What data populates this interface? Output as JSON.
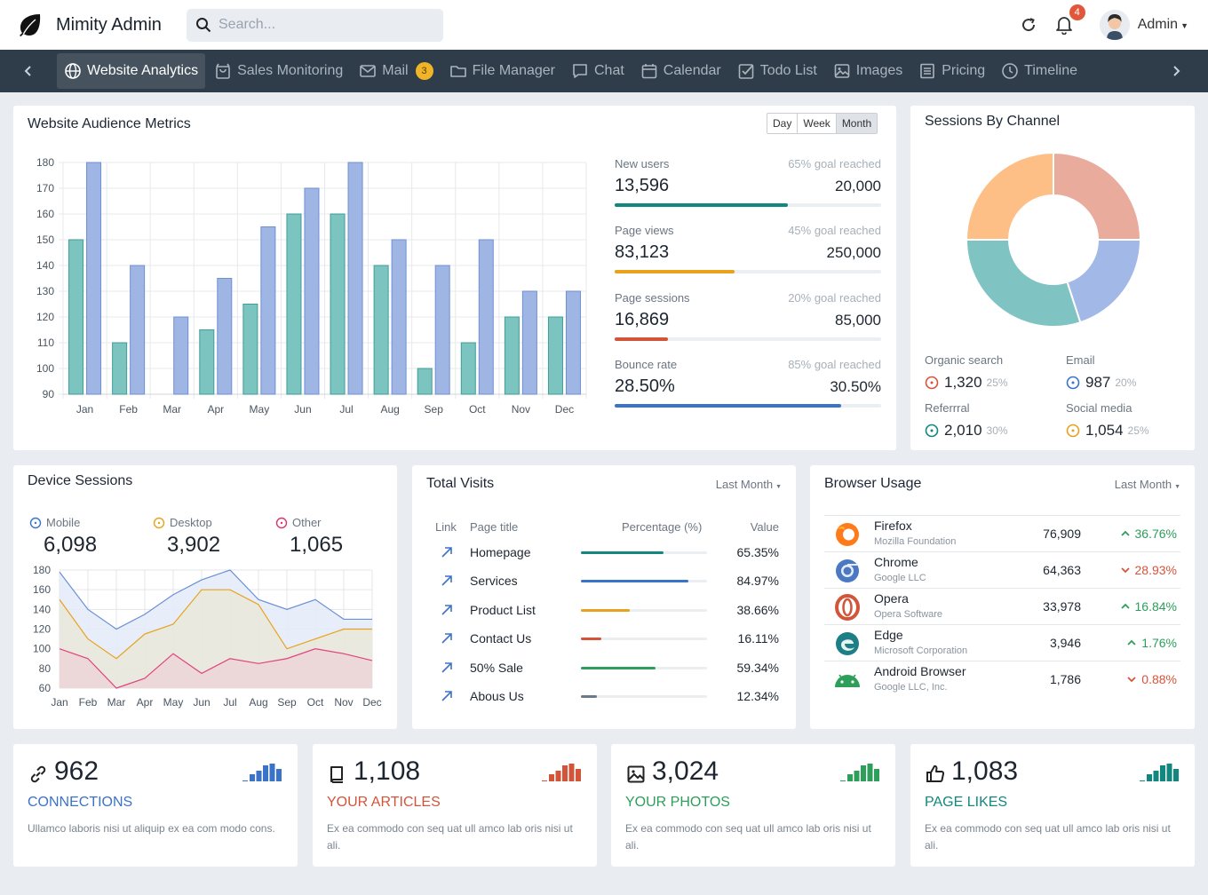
{
  "app": {
    "title": "Mimity Admin",
    "search_placeholder": "Search...",
    "notifications": "4",
    "user": "Admin"
  },
  "nav": {
    "items": [
      {
        "label": "Website Analytics",
        "icon": "globe-icon"
      },
      {
        "label": "Sales Monitoring",
        "icon": "bag-icon"
      },
      {
        "label": "Mail",
        "icon": "mail-icon",
        "badge": "3"
      },
      {
        "label": "File Manager",
        "icon": "folder-icon"
      },
      {
        "label": "Chat",
        "icon": "chat-icon"
      },
      {
        "label": "Calendar",
        "icon": "calendar-icon"
      },
      {
        "label": "Todo List",
        "icon": "checkbox-icon"
      },
      {
        "label": "Images",
        "icon": "image-icon"
      },
      {
        "label": "Pricing",
        "icon": "list-icon"
      },
      {
        "label": "Timeline",
        "icon": "clock-icon"
      }
    ]
  },
  "metrics": {
    "title": "Website Audience Metrics",
    "ranges": [
      "Day",
      "Week",
      "Month"
    ],
    "stats": [
      {
        "label": "New users",
        "goal": "65% goal reached",
        "value": "13,596",
        "total": "20,000",
        "progress": 65,
        "color": "#12877f"
      },
      {
        "label": "Page views",
        "goal": "45% goal reached",
        "value": "83,123",
        "total": "250,000",
        "progress": 45,
        "color": "#e8a21b"
      },
      {
        "label": "Page sessions",
        "goal": "20% goal reached",
        "value": "16,869",
        "total": "85,000",
        "progress": 20,
        "color": "#d2553a"
      },
      {
        "label": "Bounce rate",
        "goal": "85% goal reached",
        "value": "28.50%",
        "total": "30.50%",
        "progress": 85,
        "color": "#3b73c8"
      }
    ]
  },
  "channels": {
    "title": "Sessions By Channel",
    "items": [
      {
        "label": "Organic search",
        "value": "1,320",
        "pct": "25%",
        "color": "#d9533b"
      },
      {
        "label": "Email",
        "value": "987",
        "pct": "20%",
        "color": "#3b73c8"
      },
      {
        "label": "Referrral",
        "value": "2,010",
        "pct": "30%",
        "color": "#12877f"
      },
      {
        "label": "Social media",
        "value": "1,054",
        "pct": "25%",
        "color": "#e8a21b"
      }
    ]
  },
  "devices": {
    "title": "Device Sessions",
    "items": [
      {
        "label": "Mobile",
        "value": "6,098",
        "color": "#3b73c8"
      },
      {
        "label": "Desktop",
        "value": "3,902",
        "color": "#e8a21b"
      },
      {
        "label": "Other",
        "value": "1,065",
        "color": "#d9366b"
      }
    ]
  },
  "visits": {
    "title": "Total Visits",
    "filter": "Last Month",
    "headers": {
      "link": "Link",
      "page": "Page title",
      "pct": "Percentage (%)",
      "value": "Value"
    },
    "rows": [
      {
        "page": "Homepage",
        "value": "65.35%",
        "pct": 65.35,
        "color": "#12877f"
      },
      {
        "page": "Services",
        "value": "84.97%",
        "pct": 84.97,
        "color": "#3b73c8"
      },
      {
        "page": "Product List",
        "value": "38.66%",
        "pct": 38.66,
        "color": "#e8a21b"
      },
      {
        "page": "Contact Us",
        "value": "16.11%",
        "pct": 16.11,
        "color": "#d2553a"
      },
      {
        "page": "50% Sale",
        "value": "59.34%",
        "pct": 59.34,
        "color": "#2e9e5b"
      },
      {
        "page": "Abous Us",
        "value": "12.34%",
        "pct": 12.34,
        "color": "#6b7a8a"
      }
    ]
  },
  "browsers": {
    "title": "Browser Usage",
    "filter": "Last Month",
    "rows": [
      {
        "name": "Firefox",
        "vendor": "Mozilla Foundation",
        "value": "76,909",
        "change": "36.76%",
        "dir": "up",
        "icon": "firefox-icon"
      },
      {
        "name": "Chrome",
        "vendor": "Google LLC",
        "value": "64,363",
        "change": "28.93%",
        "dir": "down",
        "icon": "chrome-icon"
      },
      {
        "name": "Opera",
        "vendor": "Opera Software",
        "value": "33,978",
        "change": "16.84%",
        "dir": "up",
        "icon": "opera-icon"
      },
      {
        "name": "Edge",
        "vendor": "Microsoft Corporation",
        "value": "3,946",
        "change": "1.76%",
        "dir": "up",
        "icon": "edge-icon"
      },
      {
        "name": "Android Browser",
        "vendor": "Google LLC, Inc.",
        "value": "1,786",
        "change": "0.88%",
        "dir": "down",
        "icon": "android-icon"
      }
    ]
  },
  "summary": [
    {
      "value": "962",
      "title": "CONNECTIONS",
      "desc": "Ullamco laboris nisi ut aliquip ex ea com modo cons.",
      "color": "#3b73c8",
      "icon": "link-icon"
    },
    {
      "value": "1,108",
      "title": "YOUR ARTICLES",
      "desc": "Ex ea commodo con seq uat ull amco lab oris nisi ut ali.",
      "color": "#d2553a",
      "icon": "book-icon"
    },
    {
      "value": "3,024",
      "title": "YOUR PHOTOS",
      "desc": "Ex ea commodo con seq uat ull amco lab oris nisi ut ali.",
      "color": "#2e9e5b",
      "icon": "image-icon"
    },
    {
      "value": "1,083",
      "title": "PAGE LIKES",
      "desc": "Ex ea commodo con seq uat ull amco lab oris nisi ut ali.",
      "color": "#12877f",
      "icon": "thumbs-up-icon"
    }
  ],
  "chart_data": [
    {
      "type": "bar",
      "categories": [
        "Jan",
        "Feb",
        "Mar",
        "Apr",
        "May",
        "Jun",
        "Jul",
        "Aug",
        "Sep",
        "Oct",
        "Nov",
        "Dec"
      ],
      "series": [
        {
          "values": [
            150,
            110,
            80,
            115,
            125,
            160,
            160,
            140,
            100,
            110,
            120,
            120
          ],
          "color": "#7cc4bf"
        },
        {
          "values": [
            180,
            140,
            120,
            135,
            155,
            170,
            180,
            150,
            140,
            150,
            130,
            130
          ],
          "color": "#9fb6e5"
        }
      ],
      "ylim": [
        90,
        180
      ],
      "yticks": [
        90,
        100,
        110,
        120,
        130,
        140,
        150,
        160,
        170,
        180
      ]
    },
    {
      "type": "pie",
      "values": [
        25,
        20,
        30,
        25
      ],
      "colors": [
        "#e9ab9c",
        "#a2b8e6",
        "#7fc4c2",
        "#fdbf85"
      ]
    },
    {
      "type": "area",
      "categories": [
        "Jan",
        "Feb",
        "Mar",
        "Apr",
        "May",
        "Jun",
        "Jul",
        "Aug",
        "Sep",
        "Oct",
        "Nov",
        "Dec"
      ],
      "series": [
        {
          "values": [
            178,
            140,
            120,
            135,
            155,
            170,
            180,
            150,
            140,
            150,
            130,
            130
          ],
          "color": "#6a8fd4",
          "fill": "#e4ebf8"
        },
        {
          "values": [
            150,
            110,
            90,
            115,
            125,
            160,
            160,
            145,
            100,
            110,
            120,
            120
          ],
          "color": "#e8a21b",
          "fill": "#e9e7da"
        },
        {
          "values": [
            100,
            90,
            60,
            70,
            95,
            75,
            90,
            85,
            90,
            100,
            95,
            88
          ],
          "color": "#e0447a",
          "fill": "#ecd5d8"
        }
      ],
      "ylim": [
        60,
        180
      ],
      "yticks": [
        60,
        80,
        100,
        120,
        140,
        160,
        180
      ]
    }
  ]
}
